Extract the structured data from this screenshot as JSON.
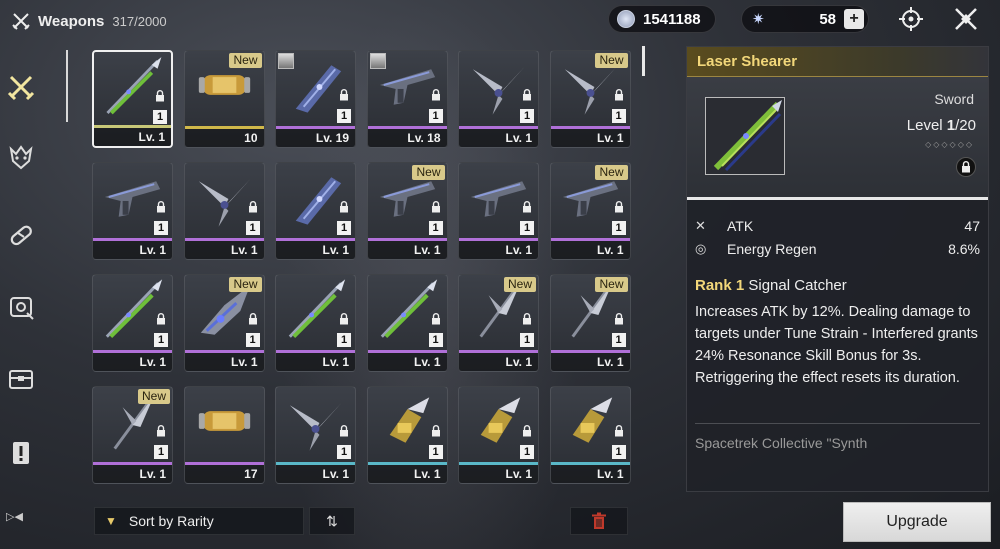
{
  "header": {
    "title": "Weapons",
    "count": "317/2000"
  },
  "currency": {
    "shell_credits": "1541188",
    "astrite": "58",
    "plus_label": "+"
  },
  "sidebar": {
    "icons": [
      "swords-icon",
      "echo-demon-icon",
      "bandage-icon",
      "tune-icon",
      "chest-icon",
      "exclamation-icon"
    ]
  },
  "grid": {
    "cards": [
      {
        "level": "Lv. 1",
        "rank": "1",
        "locked": true,
        "new": "",
        "kind": "sword",
        "bar": "#c8c878",
        "selected": true
      },
      {
        "count": "10",
        "kind": "tube",
        "bar": "#d0b84a",
        "new": "New"
      },
      {
        "level": "Lv. 19",
        "rank": "1",
        "locked": true,
        "kind": "gauntlet",
        "bar": "#b070d8",
        "avatar": true
      },
      {
        "level": "Lv. 18",
        "rank": "1",
        "locked": true,
        "kind": "pistol",
        "bar": "#b070d8",
        "avatar": true
      },
      {
        "level": "Lv. 1",
        "rank": "1",
        "locked": true,
        "kind": "claws",
        "bar": "#b070d8"
      },
      {
        "level": "Lv. 1",
        "rank": "1",
        "locked": true,
        "kind": "claws",
        "bar": "#b070d8",
        "new": "New"
      },
      {
        "level": "Lv. 1",
        "rank": "1",
        "locked": true,
        "kind": "pistol",
        "bar": "#b070d8"
      },
      {
        "level": "Lv. 1",
        "rank": "1",
        "locked": true,
        "kind": "claws",
        "bar": "#b070d8"
      },
      {
        "level": "Lv. 1",
        "rank": "1",
        "locked": true,
        "kind": "gauntlet",
        "bar": "#b070d8"
      },
      {
        "level": "Lv. 1",
        "rank": "1",
        "locked": true,
        "kind": "pistol",
        "bar": "#b070d8",
        "new": "New"
      },
      {
        "level": "Lv. 1",
        "rank": "1",
        "locked": true,
        "kind": "pistol",
        "bar": "#b070d8"
      },
      {
        "level": "Lv. 1",
        "rank": "1",
        "locked": true,
        "kind": "pistol",
        "bar": "#b070d8",
        "new": "New"
      },
      {
        "level": "Lv. 1",
        "rank": "1",
        "locked": true,
        "kind": "sword",
        "bar": "#b070d8"
      },
      {
        "level": "Lv. 1",
        "rank": "1",
        "locked": true,
        "kind": "broadblade",
        "bar": "#b070d8",
        "new": "New"
      },
      {
        "level": "Lv. 1",
        "rank": "1",
        "locked": true,
        "kind": "sword",
        "bar": "#b070d8"
      },
      {
        "level": "Lv. 1",
        "rank": "1",
        "locked": true,
        "kind": "sword",
        "bar": "#b070d8"
      },
      {
        "level": "Lv. 1",
        "rank": "1",
        "locked": true,
        "kind": "spear",
        "bar": "#b070d8",
        "new": "New"
      },
      {
        "level": "Lv. 1",
        "rank": "1",
        "locked": true,
        "kind": "spear",
        "bar": "#b070d8",
        "new": "New"
      },
      {
        "level": "Lv. 1",
        "rank": "1",
        "locked": true,
        "kind": "spear",
        "bar": "#b070d8",
        "new": "New"
      },
      {
        "count": "17",
        "kind": "tube",
        "bar": "#b070d8"
      },
      {
        "level": "Lv. 1",
        "rank": "1",
        "locked": true,
        "kind": "claws",
        "bar": "#5ab8c8"
      },
      {
        "level": "Lv. 1",
        "rank": "1",
        "locked": true,
        "kind": "gold",
        "bar": "#5ab8c8"
      },
      {
        "level": "Lv. 1",
        "rank": "1",
        "locked": true,
        "kind": "gold",
        "bar": "#5ab8c8"
      },
      {
        "level": "Lv. 1",
        "rank": "1",
        "locked": true,
        "kind": "gold",
        "bar": "#5ab8c8"
      }
    ]
  },
  "sort": {
    "label": "Sort by Rarity"
  },
  "detail": {
    "name": "Laser Shearer",
    "type": "Sword",
    "level_label": "Level",
    "level_current": "1",
    "level_max": "/20",
    "stats": [
      {
        "name": "ATK",
        "value": "47",
        "icon": "swords-icon"
      },
      {
        "name": "Energy Regen",
        "value": "8.6%",
        "icon": "energy-regen-icon"
      }
    ],
    "rank_label": "Rank 1",
    "passive_name": "Signal Catcher",
    "description": "Increases ATK by 12%. Dealing damage to targets under Tune Strain - Interfered grants 24% Resonance Skill Bonus for 3s. Retriggering the effect resets its duration.",
    "lore": "Spacetrek Collective \"Synth"
  },
  "upgrade_label": "Upgrade",
  "colors": {
    "accent_gold": "#f2d77a",
    "new_badge": "#d8c98a",
    "rarity_purple": "#b070d8",
    "rarity_blue": "#5ab8c8"
  }
}
